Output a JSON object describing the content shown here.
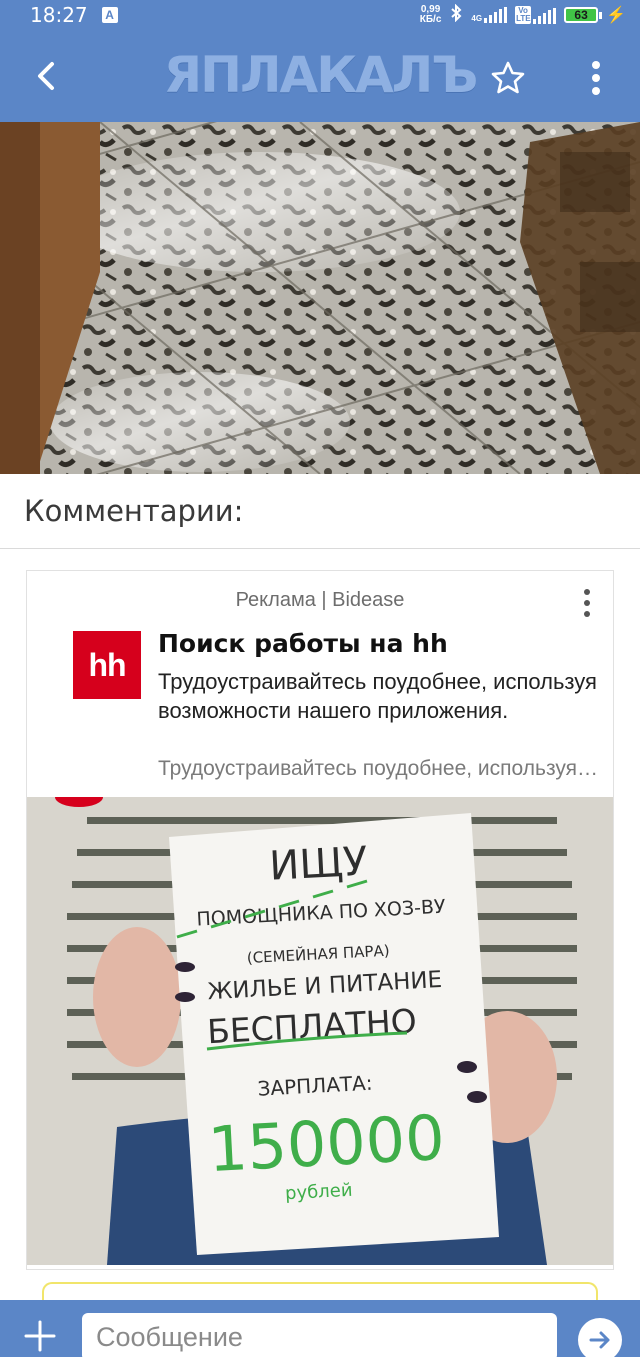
{
  "status_bar": {
    "time": "18:27",
    "notification_letter": "A",
    "net_speed_value": "0,99",
    "net_speed_unit": "КБ/с",
    "sim_tag_1": "4G",
    "sim_tag_2": "Vo LTE",
    "battery_level": "63",
    "icons": [
      "bluetooth-icon",
      "signal-icon",
      "battery-icon",
      "charging-icon"
    ]
  },
  "header": {
    "logo_text": "ЯПЛАКАЛЪ",
    "icons": [
      "back-arrow-icon",
      "star-icon",
      "more-vert-icon"
    ]
  },
  "comments": {
    "title": "Комментарии:"
  },
  "ad": {
    "label": "Реклама | Bidease",
    "logo_text": "hh",
    "title": "Поиск работы на hh",
    "description": "Трудоустраивайтесь поудобнее, используя возможности нашего приложения.",
    "subtitle": "Трудоустраивайтесь поудобнее, используя возможности нашего приложения.",
    "image_sign": {
      "line1": "ИЩУ",
      "line2": "ПОМОЩНИКА ПО ХОЗ-ВУ",
      "line3": "(СЕМЕЙНАЯ ПАРА)",
      "line4": "ЖИЛЬЕ И ПИТАНИЕ",
      "line5": "БЕСПЛАТНО",
      "line6": "ЗАРПЛАТА:",
      "amount": "150000",
      "currency": "рублей"
    }
  },
  "message_bar": {
    "placeholder": "Сообщение"
  },
  "colors": {
    "header_blue": "#5b86c7",
    "hh_red": "#d6001c",
    "battery_green": "#41c447",
    "sign_green": "#3fae4a"
  }
}
